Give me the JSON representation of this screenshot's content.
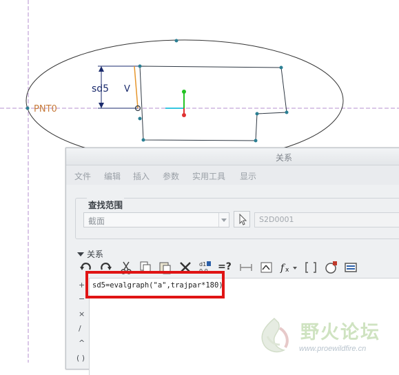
{
  "sketch": {
    "point_label": "PNT0",
    "dimension_label": "sd5",
    "v_label": "V"
  },
  "dialog": {
    "title": "关系",
    "menu": [
      "文件",
      "编辑",
      "插入",
      "参数",
      "实用工具",
      "显示"
    ],
    "find_scope": {
      "title": "查找范围",
      "type_value": "截面",
      "name_value": "S2D0001"
    },
    "relations_section": "关系",
    "toolbar_icons": [
      "undo-icon",
      "redo-icon",
      "cut-icon",
      "copy-icon",
      "paste-icon",
      "delete-icon",
      "switch-dimensions-icon",
      "evaluate-icon",
      "local-parameters-icon",
      "sort-icon",
      "function-icon",
      "brackets-icon",
      "verify-icon",
      "show-icon"
    ],
    "equals_q": "=?",
    "relation_text": "sd5=evalgraph(\"a\",trajpar*180)",
    "side_keys": [
      "+",
      "−",
      "×",
      "/",
      "^",
      "( )"
    ]
  },
  "watermark": {
    "text": "野火论坛",
    "url": "www.proewildfire.cn"
  },
  "colors": {
    "highlight": "#e01414",
    "sketch_point": "#2b7f93",
    "axis_green": "#22c322",
    "axis_red": "#e03131",
    "axis_cyan": "#36c6e0"
  }
}
